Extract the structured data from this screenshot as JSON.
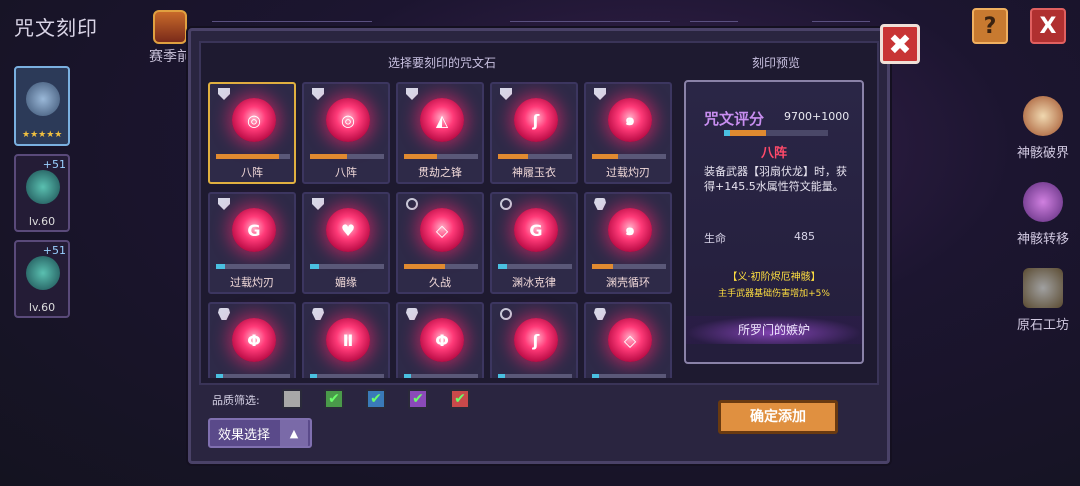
{
  "background": {
    "title": "咒文刻印",
    "season_label": "赛季前",
    "help_symbol": "?",
    "close_symbol": "X"
  },
  "characters": [
    {
      "level": "",
      "plus": "",
      "active": true,
      "stars": "★★★★★"
    },
    {
      "level": "lv.60",
      "plus": "+51"
    },
    {
      "level": "lv.60",
      "plus": "+51"
    }
  ],
  "side_menu": [
    {
      "label": "神骸破界",
      "icon": "relic-break-icon"
    },
    {
      "label": "神骸转移",
      "icon": "relic-transfer-icon"
    },
    {
      "label": "原石工坊",
      "icon": "workshop-icon"
    }
  ],
  "panel": {
    "select_title": "选择要刻印的咒文石",
    "preview_title": "刻印预览",
    "close_symbol": "✖"
  },
  "runes": [
    {
      "name": "八阵",
      "glyph": "◎",
      "tier": "crest",
      "fill": 0.85,
      "color": "#e08a30",
      "selected": true
    },
    {
      "name": "八阵",
      "glyph": "◎",
      "tier": "crest",
      "fill": 0.5,
      "color": "#e08a30"
    },
    {
      "name": "贯劫之锋",
      "glyph": "◭",
      "tier": "crest",
      "fill": 0.45,
      "color": "#e08a30"
    },
    {
      "name": "神履玉衣",
      "glyph": "ʃ",
      "tier": "crest",
      "fill": 0.4,
      "color": "#e08a30"
    },
    {
      "name": "过载灼刃",
      "glyph": "๑",
      "tier": "crest",
      "fill": 0.35,
      "color": "#e08a30"
    },
    {
      "name": "过载灼刃",
      "glyph": "G",
      "tier": "crest",
      "fill": 0.12,
      "color": "#4ac0e0"
    },
    {
      "name": "媚缘",
      "glyph": "♥",
      "tier": "crest",
      "fill": 0.12,
      "color": "#4ac0e0"
    },
    {
      "name": "久战",
      "glyph": "◇",
      "tier": "ring",
      "fill": 0.55,
      "color": "#e08a30"
    },
    {
      "name": "渊冰克律",
      "glyph": "G",
      "tier": "ring",
      "fill": 0.12,
      "color": "#4ac0e0"
    },
    {
      "name": "渊壳循环",
      "glyph": "๑",
      "tier": "cup",
      "fill": 0.28,
      "color": "#e08a30"
    },
    {
      "name": "",
      "glyph": "Φ",
      "tier": "cup",
      "fill": 0.1,
      "color": "#4ac0e0"
    },
    {
      "name": "",
      "glyph": "Ⅱ",
      "tier": "cup",
      "fill": 0.1,
      "color": "#4ac0e0"
    },
    {
      "name": "",
      "glyph": "Φ",
      "tier": "cup",
      "fill": 0.1,
      "color": "#4ac0e0"
    },
    {
      "name": "",
      "glyph": "ʃ",
      "tier": "ring",
      "fill": 0.1,
      "color": "#4ac0e0"
    },
    {
      "name": "",
      "glyph": "◇",
      "tier": "cup",
      "fill": 0.1,
      "color": "#4ac0e0"
    }
  ],
  "preview": {
    "score_label": "咒文评分",
    "score_value": "9700+1000",
    "rune_name": "八阵",
    "description": "装备武器【羽扇伏龙】时，获得+145.5水属性符文能量。",
    "stat_label": "生命",
    "stat_value": "485",
    "set_name": "【义·初阶烬厄神骸】",
    "set_desc": "主手武器基础伤害增加+5%",
    "source": "所罗门的嫉妒"
  },
  "filter": {
    "label": "品质筛选:",
    "boxes": [
      {
        "checked": false,
        "color": "#a8a8a8"
      },
      {
        "checked": true,
        "color": "#4a9a4a"
      },
      {
        "checked": true,
        "color": "#3a7ab8"
      },
      {
        "checked": true,
        "color": "#8a4ab8"
      },
      {
        "checked": true,
        "color": "#c84a4a"
      }
    ],
    "check_symbol": "✔"
  },
  "buttons": {
    "effect_select": "效果选择",
    "effect_arrow": "▲",
    "confirm": "确定添加"
  }
}
